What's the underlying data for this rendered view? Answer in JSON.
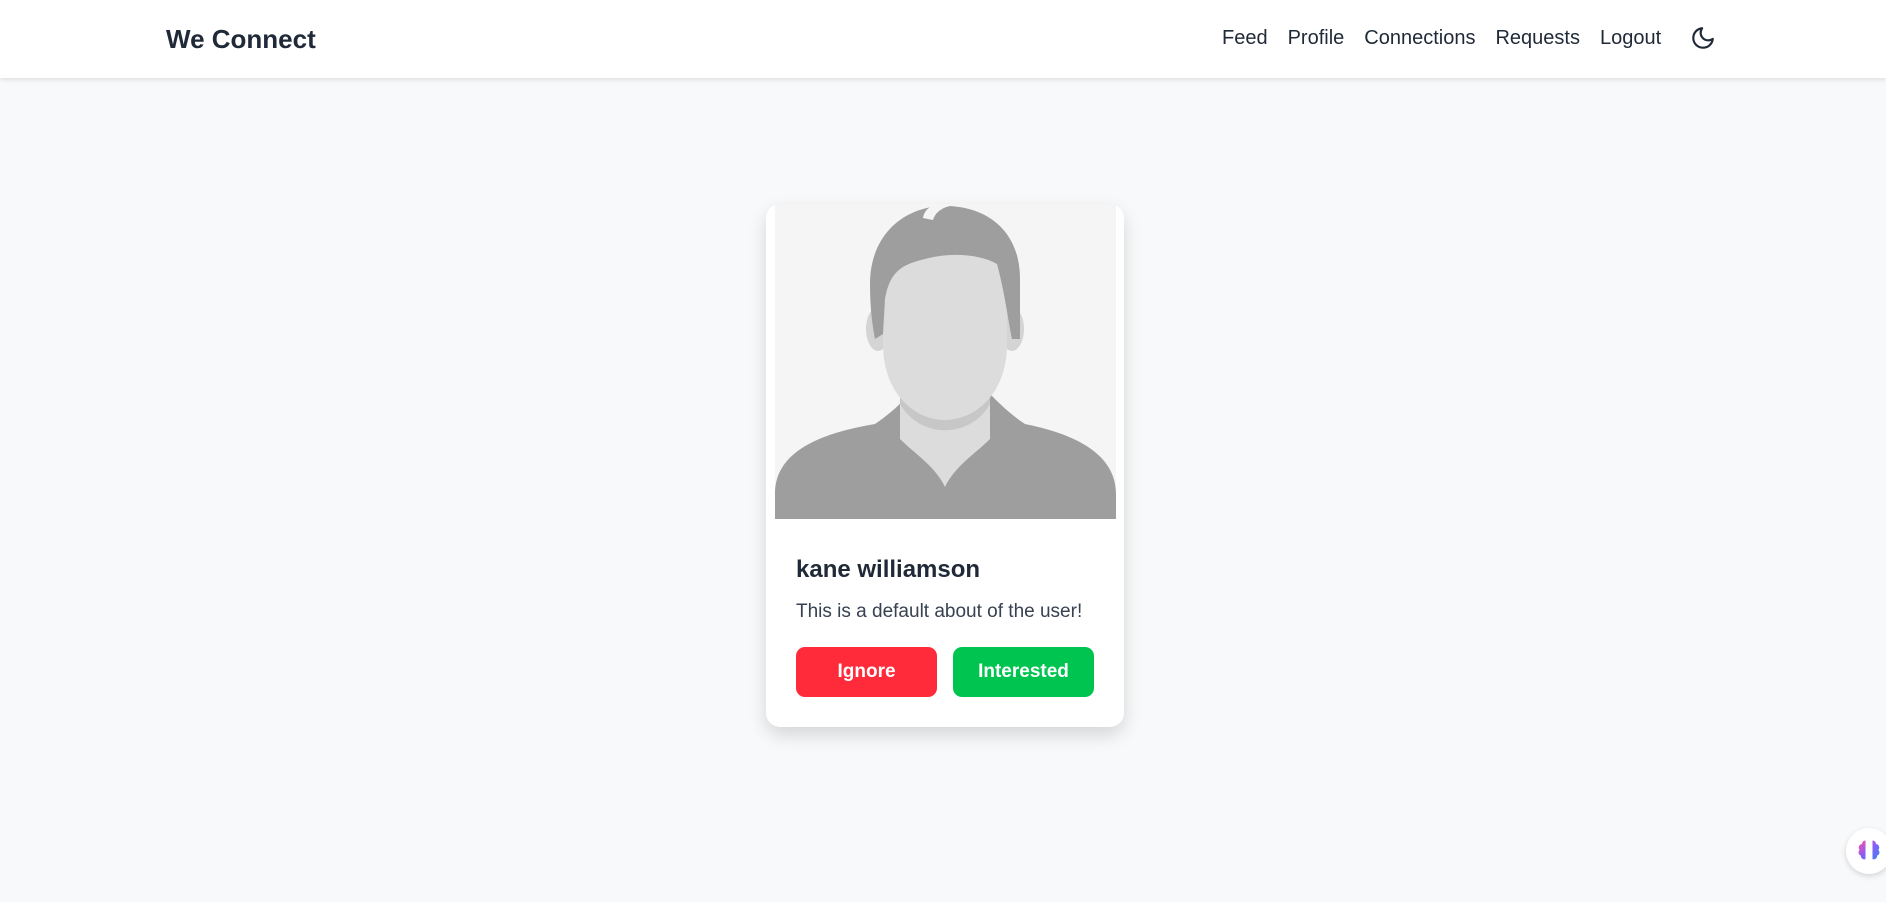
{
  "navbar": {
    "brand": "We Connect",
    "links": [
      {
        "label": "Feed"
      },
      {
        "label": "Profile"
      },
      {
        "label": "Connections"
      },
      {
        "label": "Requests"
      },
      {
        "label": "Logout"
      }
    ],
    "theme_toggle_icon": "moon-icon"
  },
  "card": {
    "avatar_icon": "default-user-avatar",
    "name": "kane williamson",
    "about": "This is a default about of the user!",
    "ignore_label": "Ignore",
    "interested_label": "Interested"
  },
  "colors": {
    "ignore": "#ff2a3a",
    "interested": "#00c450",
    "background": "#f8f9fa"
  },
  "floating_widget_icon": "brain-icon"
}
